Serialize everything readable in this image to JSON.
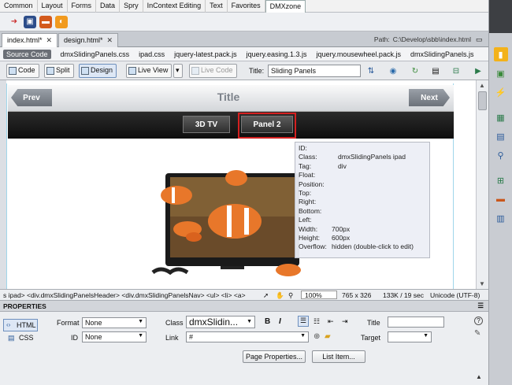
{
  "insert_bar": {
    "tabs": [
      "Common",
      "Layout",
      "Forms",
      "Data",
      "Spry",
      "InContext Editing",
      "Text",
      "Favorites",
      "DMXzone"
    ],
    "active_tab": "DMXzone"
  },
  "doc_tabs": {
    "tabs": [
      {
        "label": "index.html*"
      },
      {
        "label": "design.html*"
      }
    ],
    "path_label": "Path:",
    "path_value": "C:\\Develop\\sbb\\index.html"
  },
  "related_files": {
    "source_code": "Source Code",
    "files": [
      "dmxSlidingPanels.css",
      "ipad.css",
      "jquery-latest.pack.js",
      "jquery.easing.1.3.js",
      "jquery.mousewheel.pack.js",
      "dmxSlidingPanels.js"
    ]
  },
  "doc_toolbar": {
    "code": "Code",
    "split": "Split",
    "design": "Design",
    "live_view": "Live View",
    "live_code": "Live Code",
    "title_label": "Title:",
    "title_value": "Sliding Panels"
  },
  "design_view": {
    "prev": "Prev",
    "next": "Next",
    "title": "Title",
    "panel1": "3D TV",
    "panel2": "Panel 2",
    "tooltip": {
      "id": {
        "k": "ID:",
        "v": ""
      },
      "class": {
        "k": "Class:",
        "v": "dmxSlidingPanels ipad"
      },
      "tag": {
        "k": "Tag:",
        "v": "div"
      },
      "float": {
        "k": "Float:",
        "v": ""
      },
      "position": {
        "k": "Position:",
        "v": ""
      },
      "top": {
        "k": "Top:",
        "v": ""
      },
      "right": {
        "k": "Right:",
        "v": ""
      },
      "bottom": {
        "k": "Bottom:",
        "v": ""
      },
      "left": {
        "k": "Left:",
        "v": ""
      },
      "width": {
        "k": "Width:",
        "v": "700px"
      },
      "height": {
        "k": "Height:",
        "v": "600px"
      },
      "overflow": {
        "k": "Overflow:",
        "v": "hidden (double-click to edit)"
      }
    }
  },
  "status_bar": {
    "tags": "s ipad> <div.dmxSlidingPanelsHeader> <div.dmxSlidingPanelsNav> <ul> <li> <a>",
    "zoom": "100%",
    "size": "765 x 326",
    "download": "133K / 19 sec",
    "encoding": "Unicode (UTF-8)"
  },
  "properties": {
    "header": "PROPERTIES",
    "html_btn": "HTML",
    "css_btn": "CSS",
    "format_label": "Format",
    "format_value": "None",
    "id_label": "ID",
    "id_value": "None",
    "class_label": "Class",
    "class_value": "dmxSlidin...",
    "link_label": "Link",
    "link_value": "#",
    "title_label": "Title",
    "target_label": "Target",
    "bold": "B",
    "italic": "I",
    "page_props": "Page Properties...",
    "list_item": "List Item..."
  },
  "colors": {
    "accent": "#d42020",
    "guide": "#9fd6ea"
  }
}
